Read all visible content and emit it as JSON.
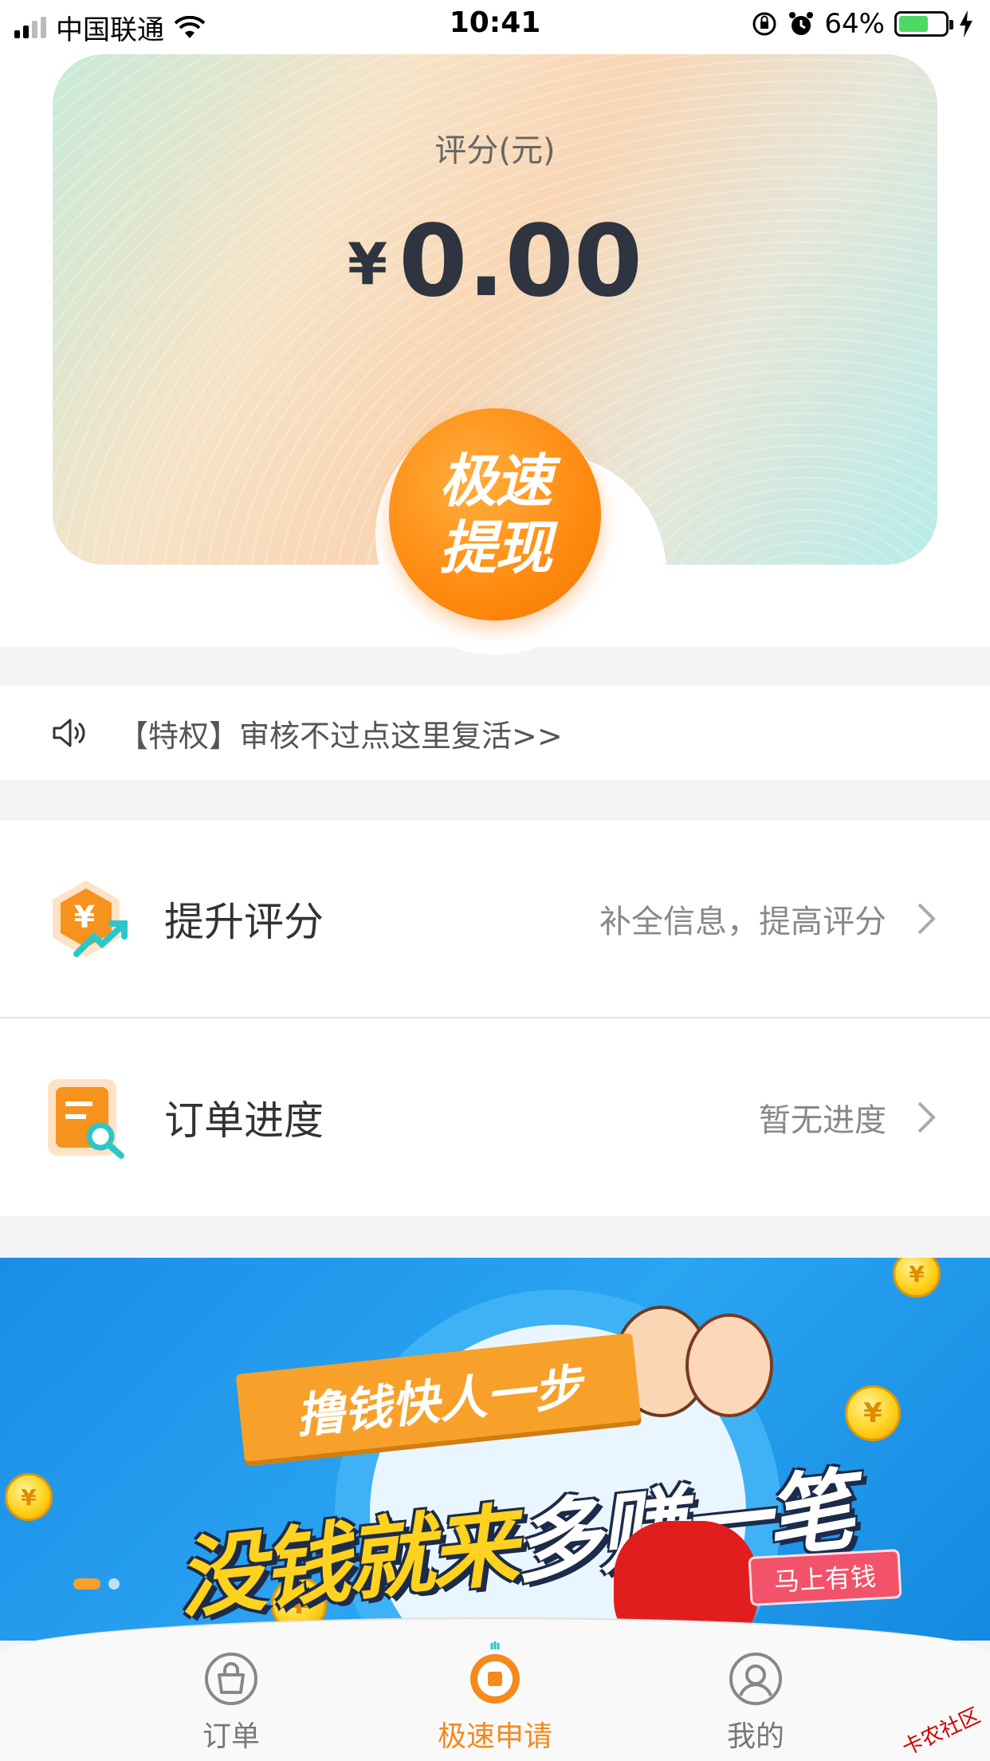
{
  "status_bar": {
    "carrier": "中国联通",
    "time": "10:41",
    "battery": "64%",
    "battery_level": 0.64
  },
  "hero": {
    "label": "评分(元)",
    "currency": "¥",
    "amount": "0.00",
    "cta_line1": "极速",
    "cta_line2": "提现"
  },
  "notice": {
    "text": "【特权】审核不过点这里复活>>",
    "icon": "speaker-icon"
  },
  "menu": [
    {
      "title": "提升评分",
      "hint": "补全信息，提高评分",
      "icon": "score-up-icon"
    },
    {
      "title": "订单进度",
      "hint": "暂无进度",
      "icon": "order-search-icon"
    }
  ],
  "banner": {
    "ribbon": "撸钱快人一步",
    "headline_a": "没钱就来",
    "headline_b": "多赚一笔",
    "go_label": "马上有钱",
    "coin_glyph": "¥",
    "active_slide": 1,
    "slide_count": 2
  },
  "tabbar": {
    "tabs": [
      {
        "label": "订单",
        "icon": "bag-icon",
        "active": false
      },
      {
        "label": "极速申请",
        "icon": "coin-apply-icon",
        "active": true
      },
      {
        "label": "我的",
        "icon": "profile-icon",
        "active": false
      }
    ]
  },
  "watermark": "卡农社区",
  "colors": {
    "accent": "#f5891e",
    "banner_blue": "#1a8ee6",
    "amount_text": "#2e3440"
  }
}
